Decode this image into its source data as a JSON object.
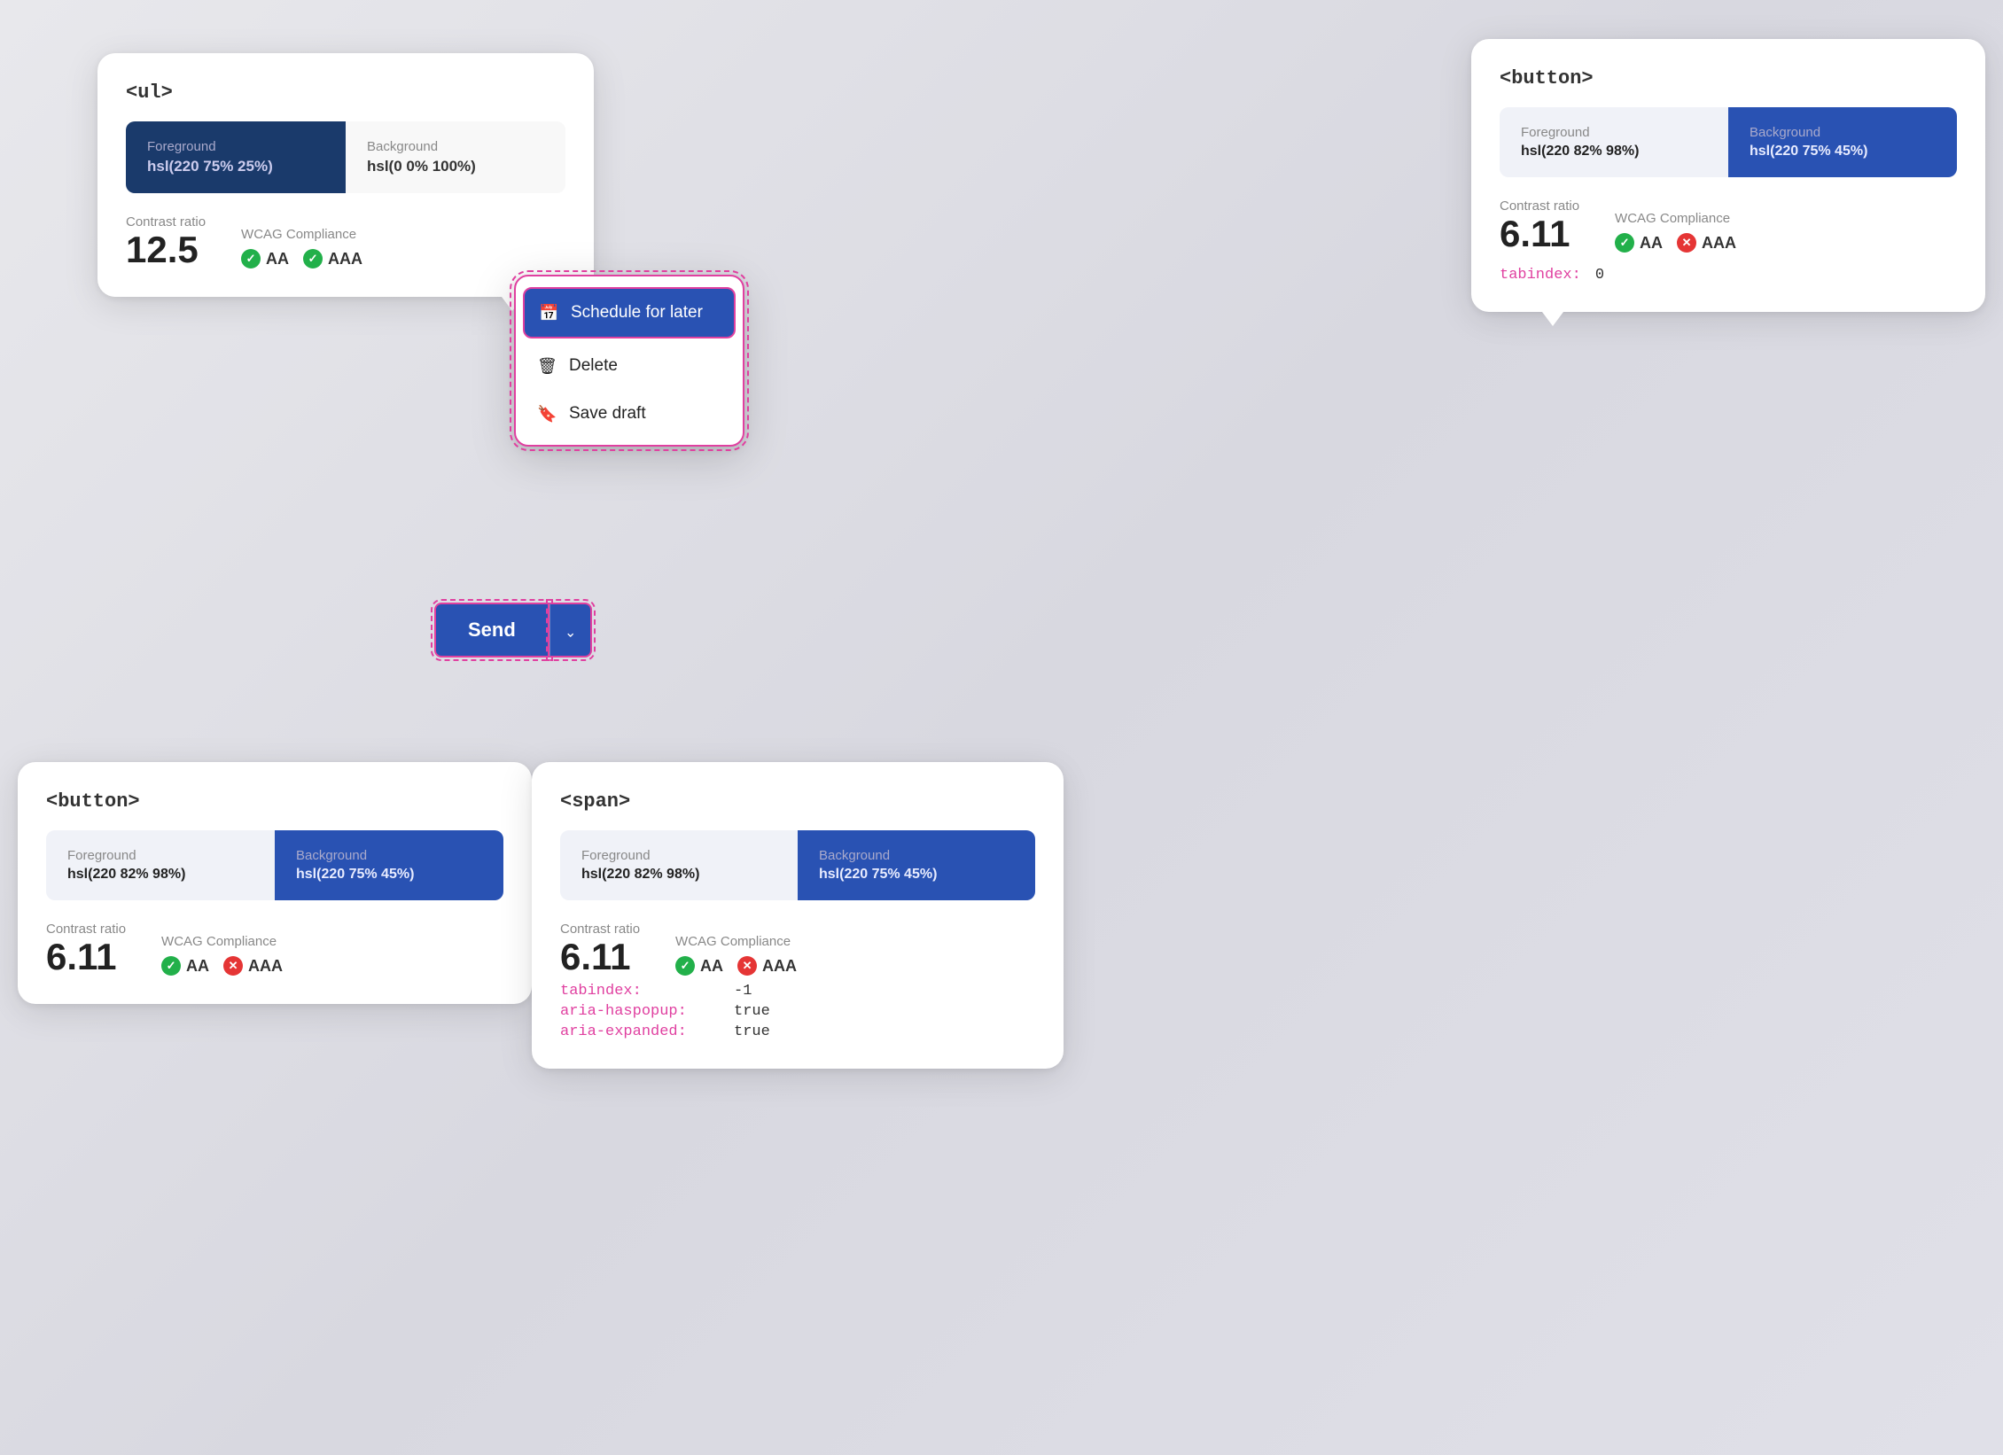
{
  "cards": {
    "ul": {
      "title": "<ul>",
      "foreground_label": "Foreground",
      "foreground_value": "hsl(220 75% 25%)",
      "background_label": "Background",
      "background_value": "hsl(0 0% 100%)",
      "contrast_label": "Contrast ratio",
      "contrast_value": "12.5",
      "wcag_label": "WCAG Compliance",
      "aa_label": "AA",
      "aaa_label": "AAA"
    },
    "button_top": {
      "title": "<button>",
      "foreground_label": "Foreground",
      "foreground_value": "hsl(220 82% 98%)",
      "background_label": "Background",
      "background_value": "hsl(220 75% 45%)",
      "contrast_label": "Contrast ratio",
      "contrast_value": "6.11",
      "wcag_label": "WCAG Compliance",
      "aa_label": "AA",
      "aaa_label": "AAA",
      "tabindex_label": "tabindex:",
      "tabindex_value": "0"
    },
    "button_bottom": {
      "title": "<button>",
      "foreground_label": "Foreground",
      "foreground_value": "hsl(220 82% 98%)",
      "background_label": "Background",
      "background_value": "hsl(220 75% 45%)",
      "contrast_label": "Contrast ratio",
      "contrast_value": "6.11",
      "wcag_label": "WCAG Compliance",
      "aa_label": "AA",
      "aaa_label": "AAA"
    },
    "span": {
      "title": "<span>",
      "foreground_label": "Foreground",
      "foreground_value": "hsl(220 82% 98%)",
      "background_label": "Background",
      "background_value": "hsl(220 75% 45%)",
      "contrast_label": "Contrast ratio",
      "contrast_value": "6.11",
      "wcag_label": "WCAG Compliance",
      "aa_label": "AA",
      "aaa_label": "AAA",
      "tabindex_label": "tabindex:",
      "tabindex_value": "-1",
      "aria_haspopup_label": "aria-haspopup:",
      "aria_haspopup_value": "true",
      "aria_expanded_label": "aria-expanded:",
      "aria_expanded_value": "true"
    }
  },
  "dropdown": {
    "schedule_icon": "📅",
    "schedule_label": "Schedule for later",
    "delete_icon": "🗑",
    "delete_label": "Delete",
    "draft_icon": "🔖",
    "draft_label": "Save draft"
  },
  "send_button": {
    "label": "Send",
    "chevron": "⌃"
  }
}
